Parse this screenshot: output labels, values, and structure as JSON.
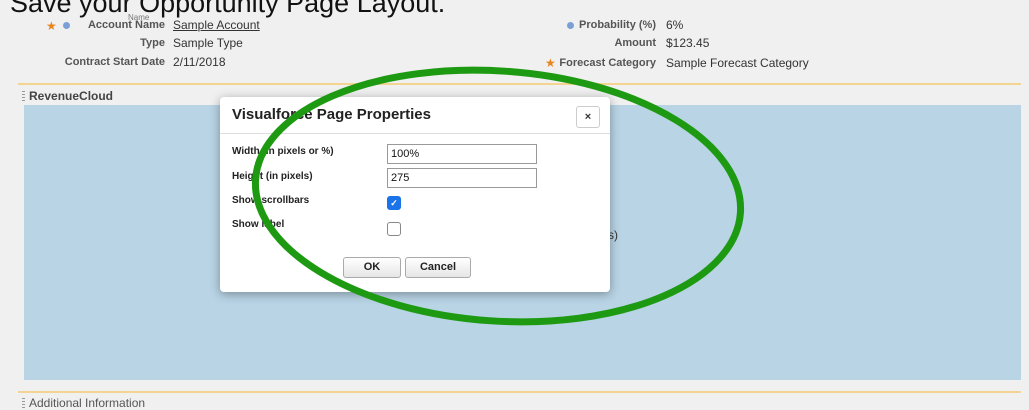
{
  "caption": "Save your Opportunity Page Layout.",
  "faint_label": "Name",
  "fields_left": [
    {
      "label": "Account Name",
      "value": "Sample Account",
      "required": true,
      "info": true,
      "link": true
    },
    {
      "label": "Type",
      "value": "Sample Type",
      "required": false,
      "info": false,
      "link": false
    },
    {
      "label": "Contract Start Date",
      "value": "2/11/2018",
      "required": false,
      "info": false,
      "link": false
    }
  ],
  "fields_right": [
    {
      "label": "Probability (%)",
      "value": "6%",
      "required": false,
      "info": true
    },
    {
      "label": "Amount",
      "value": "$123.45",
      "required": false,
      "info": false
    },
    {
      "label": "Forecast Category",
      "value": "Sample Forecast Category",
      "required": true,
      "info": false
    }
  ],
  "section_revenue": "RevenueCloud",
  "behind_text": "s)",
  "dialog": {
    "title": "Visualforce Page Properties",
    "close": "×",
    "width_label": "Width (in pixels or %)",
    "width_value": "100%",
    "height_label": "Height (in pixels)",
    "height_value": "275",
    "scrollbars_label": "Show scrollbars",
    "scrollbars_checked": true,
    "show_label_label": "Show label",
    "show_label_checked": false,
    "ok": "OK",
    "cancel": "Cancel"
  },
  "section_bottom": "Additional Information",
  "colors": {
    "annotation": "#1d9a12",
    "panel_blue": "#b8d4e5",
    "required_star": "#e8851e",
    "section_line": "#f3d491"
  }
}
